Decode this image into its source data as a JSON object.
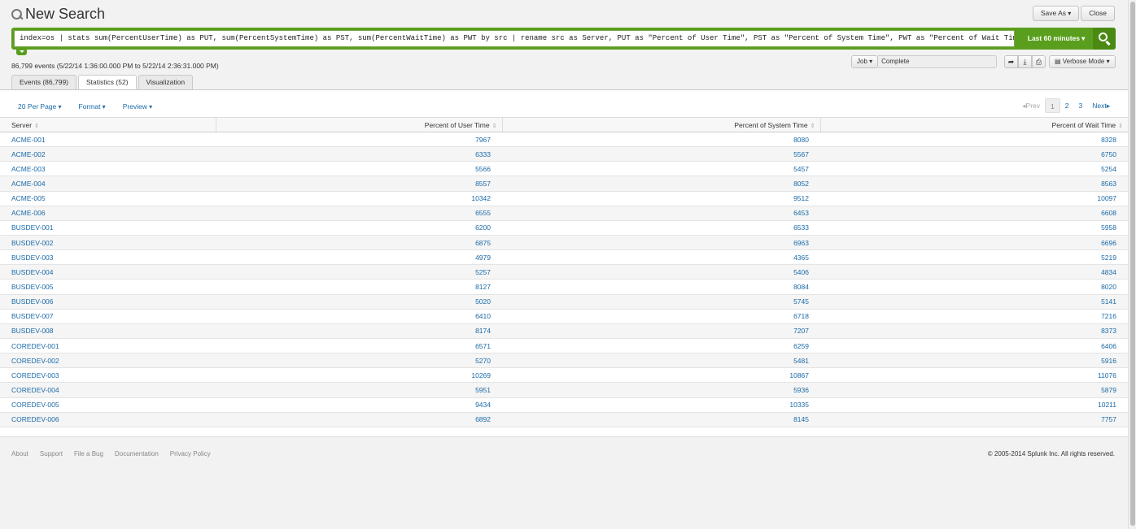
{
  "header": {
    "title": "New Search",
    "save_as": "Save As",
    "close": "Close"
  },
  "search": {
    "query": "index=os | stats sum(PercentUserTime) as PUT, sum(PercentSystemTime) as PST, sum(PercentWaitTime) as PWT by src | rename src as Server, PUT as \"Percent of User Time\", PST as \"Percent of System Time\", PWT as \"Percent of Wait Time\"",
    "time_range": "Last 60 minutes"
  },
  "event_count": "86,799 events (5/22/14 1:36:00.000 PM to 5/22/14 2:36:31.000 PM)",
  "job": {
    "label": "Job",
    "status": "Complete",
    "mode": "Verbose Mode"
  },
  "tabs": [
    {
      "label": "Events (86,799)"
    },
    {
      "label": "Statistics (52)"
    },
    {
      "label": "Visualization"
    }
  ],
  "options": {
    "per_page": "20 Per Page",
    "format": "Format",
    "preview": "Preview"
  },
  "pager": {
    "prev": "Prev",
    "pages": [
      "1",
      "2",
      "3"
    ],
    "next": "Next"
  },
  "table": {
    "columns": [
      "Server",
      "Percent of User Time",
      "Percent of System Time",
      "Percent of Wait Time"
    ],
    "rows": [
      [
        "ACME-001",
        "7967",
        "8080",
        "8328"
      ],
      [
        "ACME-002",
        "6333",
        "5567",
        "6750"
      ],
      [
        "ACME-003",
        "5566",
        "5457",
        "5254"
      ],
      [
        "ACME-004",
        "8557",
        "8052",
        "8563"
      ],
      [
        "ACME-005",
        "10342",
        "9512",
        "10097"
      ],
      [
        "ACME-006",
        "6555",
        "6453",
        "6608"
      ],
      [
        "BUSDEV-001",
        "6200",
        "6533",
        "5958"
      ],
      [
        "BUSDEV-002",
        "6875",
        "6963",
        "6696"
      ],
      [
        "BUSDEV-003",
        "4979",
        "4365",
        "5219"
      ],
      [
        "BUSDEV-004",
        "5257",
        "5406",
        "4834"
      ],
      [
        "BUSDEV-005",
        "8127",
        "8084",
        "8020"
      ],
      [
        "BUSDEV-006",
        "5020",
        "5745",
        "5141"
      ],
      [
        "BUSDEV-007",
        "6410",
        "6718",
        "7216"
      ],
      [
        "BUSDEV-008",
        "8174",
        "7207",
        "8373"
      ],
      [
        "COREDEV-001",
        "6571",
        "6259",
        "6406"
      ],
      [
        "COREDEV-002",
        "5270",
        "5481",
        "5916"
      ],
      [
        "COREDEV-003",
        "10269",
        "10867",
        "11076"
      ],
      [
        "COREDEV-004",
        "5951",
        "5936",
        "5879"
      ],
      [
        "COREDEV-005",
        "9434",
        "10335",
        "10211"
      ],
      [
        "COREDEV-006",
        "6892",
        "8145",
        "7757"
      ]
    ]
  },
  "footer": {
    "links": [
      "About",
      "Support",
      "File a Bug",
      "Documentation",
      "Privacy Policy"
    ],
    "copyright": "© 2005-2014 Splunk Inc. All rights reserved."
  }
}
